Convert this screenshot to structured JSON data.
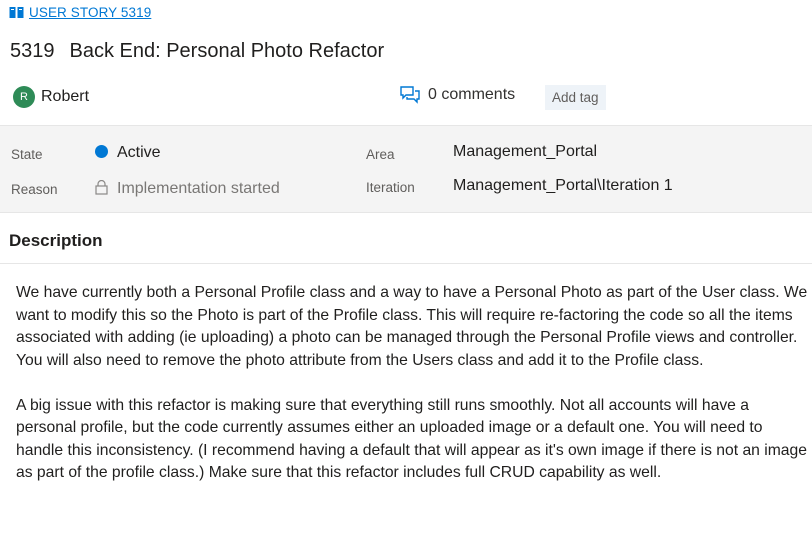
{
  "workitem": {
    "type_link": "USER STORY 5319",
    "id": "5319",
    "title": "Back End: Personal Photo Refactor"
  },
  "meta": {
    "assignee_initial": "R",
    "assignee_name": "Robert",
    "comments_label": "0 comments",
    "add_tag_label": "Add tag"
  },
  "fields": {
    "state_label": "State",
    "state_value": "Active",
    "reason_label": "Reason",
    "reason_value": "Implementation started",
    "area_label": "Area",
    "area_value": "Management_Portal",
    "iteration_label": "Iteration",
    "iteration_value": "Management_Portal\\Iteration 1"
  },
  "description": {
    "heading": "Description",
    "paragraphs": [
      "We have currently both a Personal Profile class and a way to have a Personal Photo as part of the User class. We want to modify this so the Photo is part of the Profile class. This will require re-factoring the code so all the items associated with adding (ie uploading) a photo can be managed through the Personal Profile views and controller. You will also need to remove the photo attribute from the Users class and add it to the Profile class.",
      "A big issue with this refactor is making sure that everything still runs smoothly. Not all accounts will have a personal profile, but the code currently assumes either an uploaded image or a default one. You will need to handle this inconsistency. (I recommend having a default that will appear as it's own image if there is not an image as part of the profile class.) Make sure that this refactor includes full CRUD capability as well."
    ]
  },
  "colors": {
    "accent": "#0078d4",
    "state_active": "#0078d4",
    "avatar_bg": "#2e8b57"
  },
  "icons": {
    "type": "book-icon",
    "comments": "comments-icon",
    "reason": "lock-icon"
  }
}
